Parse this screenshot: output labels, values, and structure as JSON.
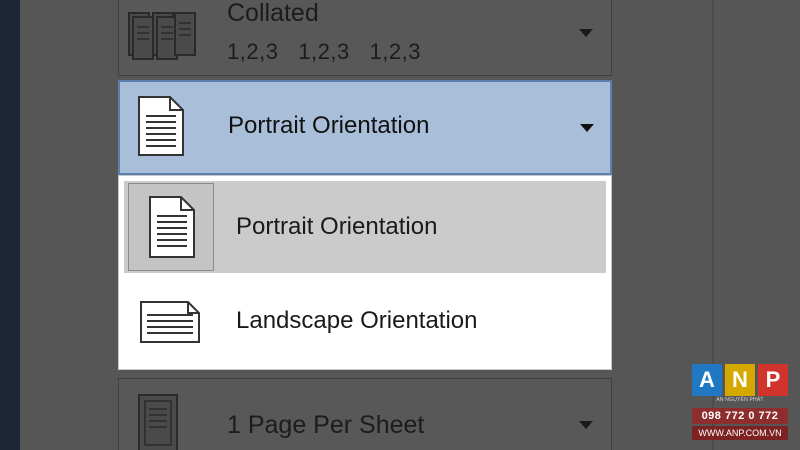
{
  "collated": {
    "label": "Collated",
    "sequence": "1,2,3   1,2,3   1,2,3",
    "icon": "collated-pages-icon"
  },
  "orientation": {
    "selected_label": "Portrait Orientation",
    "icon": "portrait-page-icon",
    "options": [
      {
        "label": "Portrait Orientation",
        "icon": "portrait-page-icon",
        "highlighted": true
      },
      {
        "label": "Landscape Orientation",
        "icon": "landscape-page-icon",
        "highlighted": false
      }
    ]
  },
  "pages_per_sheet": {
    "label": "1 Page Per Sheet",
    "icon": "single-page-icon"
  },
  "watermark": {
    "letters": [
      "A",
      "N",
      "P"
    ],
    "letter_colors": [
      "#1f78c1",
      "#d4a800",
      "#d0342c"
    ],
    "tagline": "AN NGUYÊN PHÁT",
    "phone": "098 772 0 772",
    "website": "WWW.ANP.COM.VN"
  },
  "colors": {
    "selected_bg": "#a9bfd9",
    "selected_border": "#5c7fae",
    "highlight_bg": "#cbcbcb",
    "backdrop": "#565656"
  }
}
